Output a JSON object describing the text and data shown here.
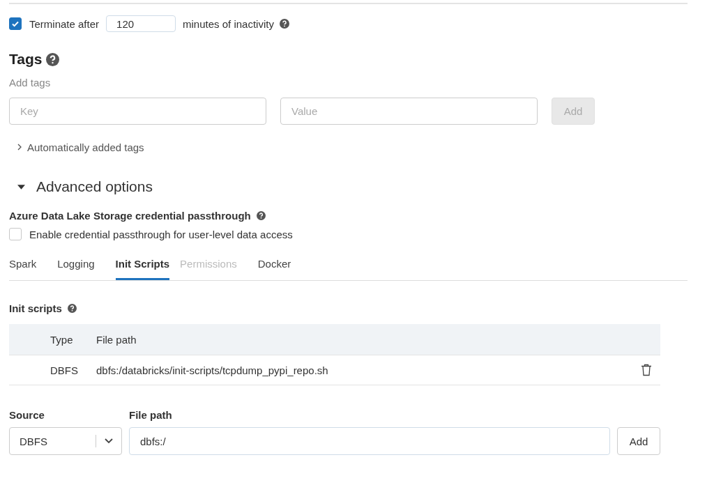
{
  "termination": {
    "checked": true,
    "label": "Terminate after",
    "value": "120",
    "suffix": "minutes of inactivity"
  },
  "tags": {
    "heading": "Tags",
    "subheading": "Add tags",
    "key_placeholder": "Key",
    "value_placeholder": "Value",
    "add_button": {
      "label": "Add",
      "disabled": true
    },
    "auto_tags": {
      "label": "Automatically added tags",
      "expanded": false
    }
  },
  "advanced": {
    "label": "Advanced options",
    "expanded": true
  },
  "passthrough": {
    "heading": "Azure Data Lake Storage credential passthrough",
    "checkbox": {
      "label": "Enable credential passthrough for user-level data access",
      "checked": false
    }
  },
  "tabs": [
    {
      "label": "Spark",
      "selected": false,
      "disabled": false
    },
    {
      "label": "Logging",
      "selected": false,
      "disabled": false
    },
    {
      "label": "Init Scripts",
      "selected": true,
      "disabled": false
    },
    {
      "label": "Permissions",
      "selected": false,
      "disabled": true
    },
    {
      "label": "Docker",
      "selected": false,
      "disabled": false
    }
  ],
  "init_scripts": {
    "heading": "Init scripts",
    "table": {
      "columns": [
        "Type",
        "File path"
      ],
      "rows": [
        {
          "type": "DBFS",
          "file_path": "dbfs:/databricks/init-scripts/tcpdump_pypi_repo.sh"
        }
      ]
    },
    "source_label": "Source",
    "source_value": "DBFS",
    "path_label": "File path",
    "path_value": "dbfs:/",
    "add_button": {
      "label": "Add",
      "disabled": false
    }
  }
}
